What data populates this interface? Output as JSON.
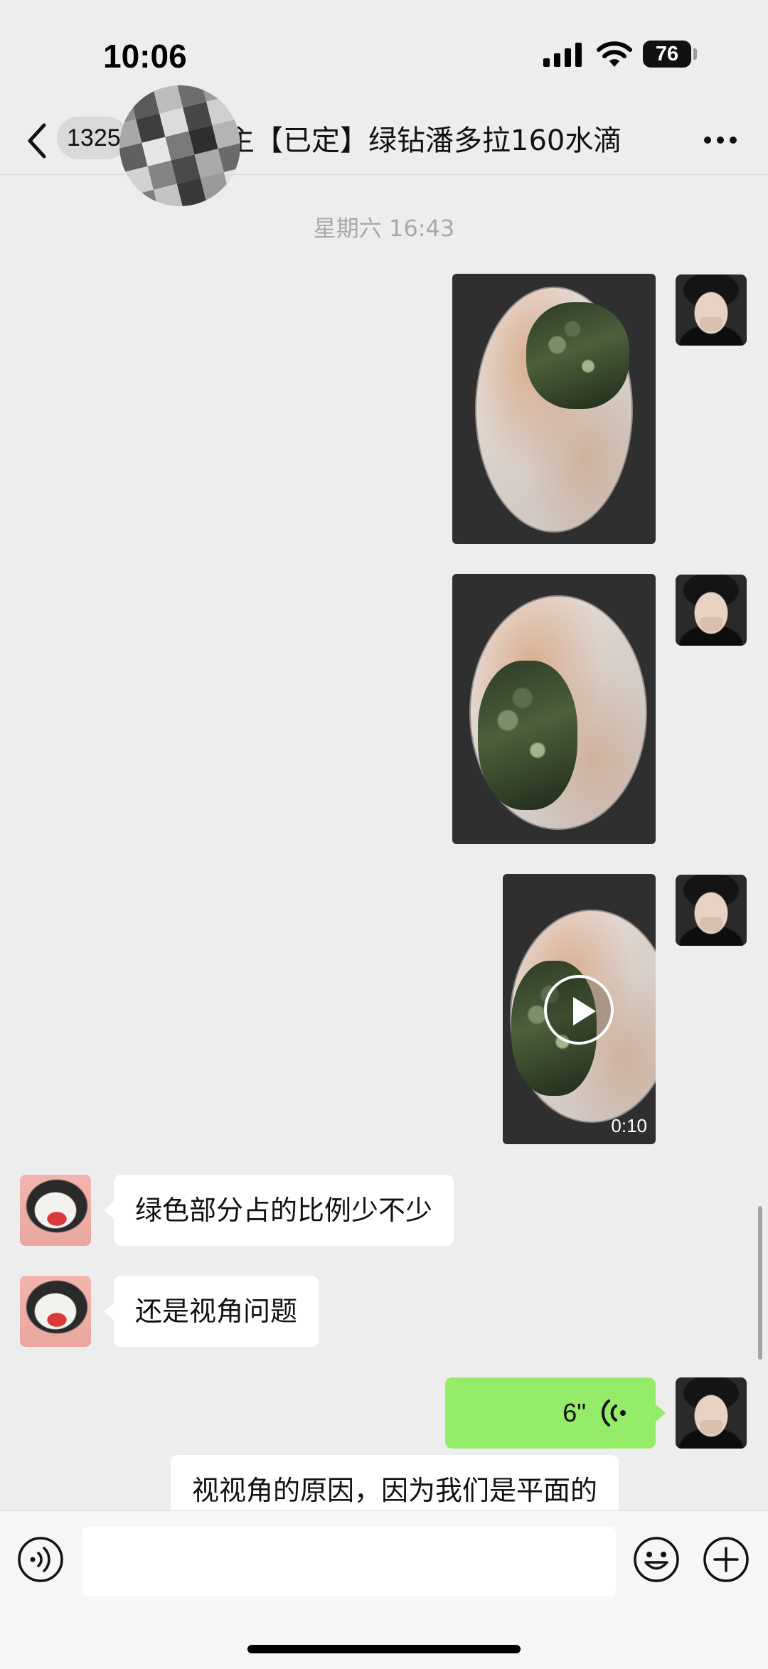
{
  "status_bar": {
    "time": "10:06",
    "battery": "76"
  },
  "header": {
    "unread_count": "1325",
    "title": "主【已定】绿钻潘多拉160水滴",
    "back_icon": "chevron-left-icon",
    "more_icon": "ellipsis-icon"
  },
  "chat": {
    "timestamp": "星期六 16:43",
    "messages": [
      {
        "type": "image",
        "sender": "me"
      },
      {
        "type": "image",
        "sender": "me"
      },
      {
        "type": "video",
        "sender": "me",
        "duration": "0:10"
      },
      {
        "type": "text",
        "sender": "other",
        "text": "绿色部分占的比例少不少"
      },
      {
        "type": "text",
        "sender": "other",
        "text": "还是视角问题"
      },
      {
        "type": "voice",
        "sender": "me",
        "duration": "6\""
      },
      {
        "type": "text",
        "sender": "other",
        "text": "视视角的原因，因为我们是平面的"
      }
    ]
  },
  "input_bar": {
    "voice_icon": "voice-mode-icon",
    "emoji_icon": "emoji-icon",
    "plus_icon": "plus-circle-icon",
    "input_value": ""
  },
  "colors": {
    "background": "#ededed",
    "voice_bubble": "#95ec69",
    "incoming_bubble": "#ffffff"
  }
}
